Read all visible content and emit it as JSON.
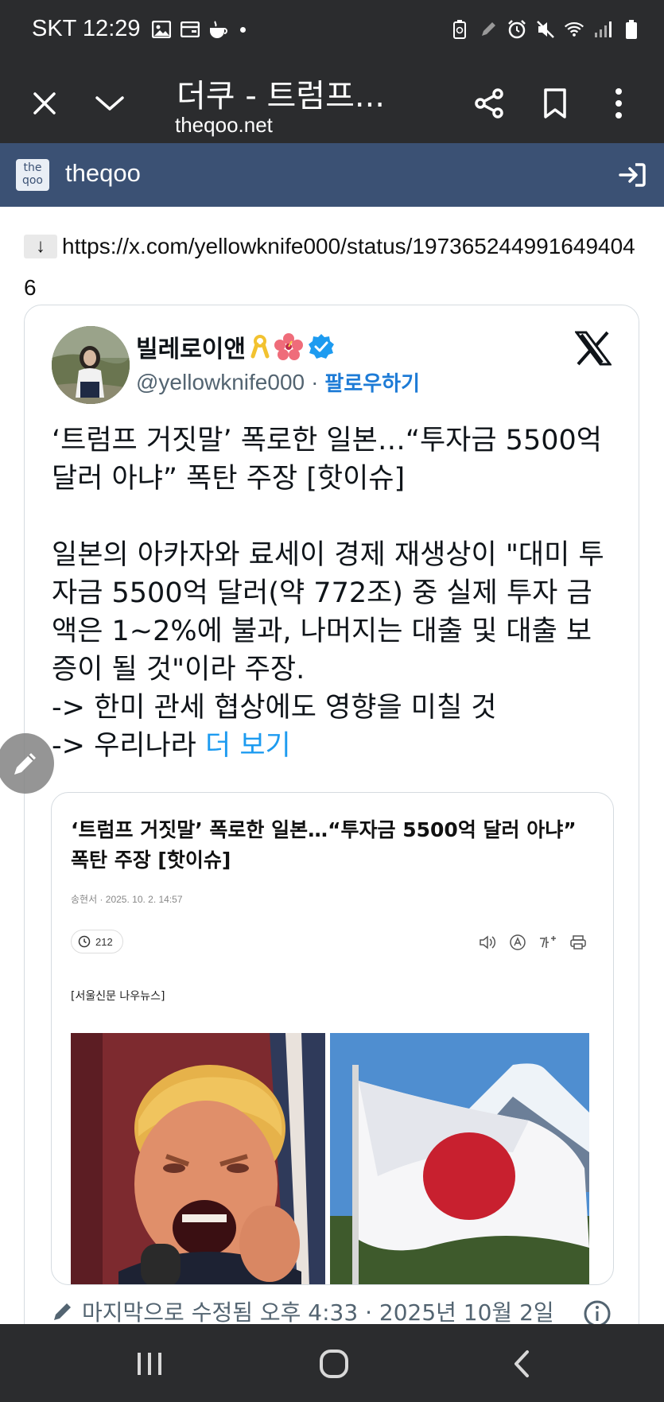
{
  "status_bar": {
    "time": "SKT 12:29"
  },
  "toolbar": {
    "title": "더쿠 - 트럼프...",
    "url": "theqoo.net"
  },
  "site": {
    "logo_text_top": "the",
    "logo_text_bottom": "qoo",
    "name": "theqoo"
  },
  "post": {
    "arrow": "↓",
    "link": "https://x.com/yellowknife000/status/1973652449916494046"
  },
  "tweet": {
    "author_name": "빌레로이앤",
    "handle": "@yellowknife000",
    "separator": "·",
    "follow_label": "팔로우하기",
    "headline": "‘트럼프 거짓말’ 폭로한 일본…“투자금 5500억 달러 아냐” 폭탄 주장 [핫이슈]",
    "body_line1": "일본의 아카자와 료세이 경제 재생상이 \"대미 투자금 5500억 달러(약 772조) 중 실제 투자 금액은 1~2%에 불과, 나머지는 대출 및 대출 보증이 될 것\"이라 주장.",
    "body_line2": "-> 한미 관세 협상에도 영향을 미칠 것",
    "body_line3_prefix": "-> 우리나라 ",
    "more_label": "더 보기",
    "edited": "마지막으로 수정됨 오후 4:33 · 2025년 10월 2일"
  },
  "preview": {
    "title": "‘트럼프 거짓말’ 폭로한 일본…“투자금 5500억 달러 아냐” 폭탄 주장 [핫이슈]",
    "byline": "송현서 · 2025. 10. 2. 14:57",
    "views": "212",
    "source": "[서울신문 나우뉴스]"
  },
  "colors": {
    "bar_dark": "#2b2c2e",
    "site_header": "#3b5174",
    "link_blue": "#1d9bf0",
    "verified_blue": "#1d9bf0"
  }
}
